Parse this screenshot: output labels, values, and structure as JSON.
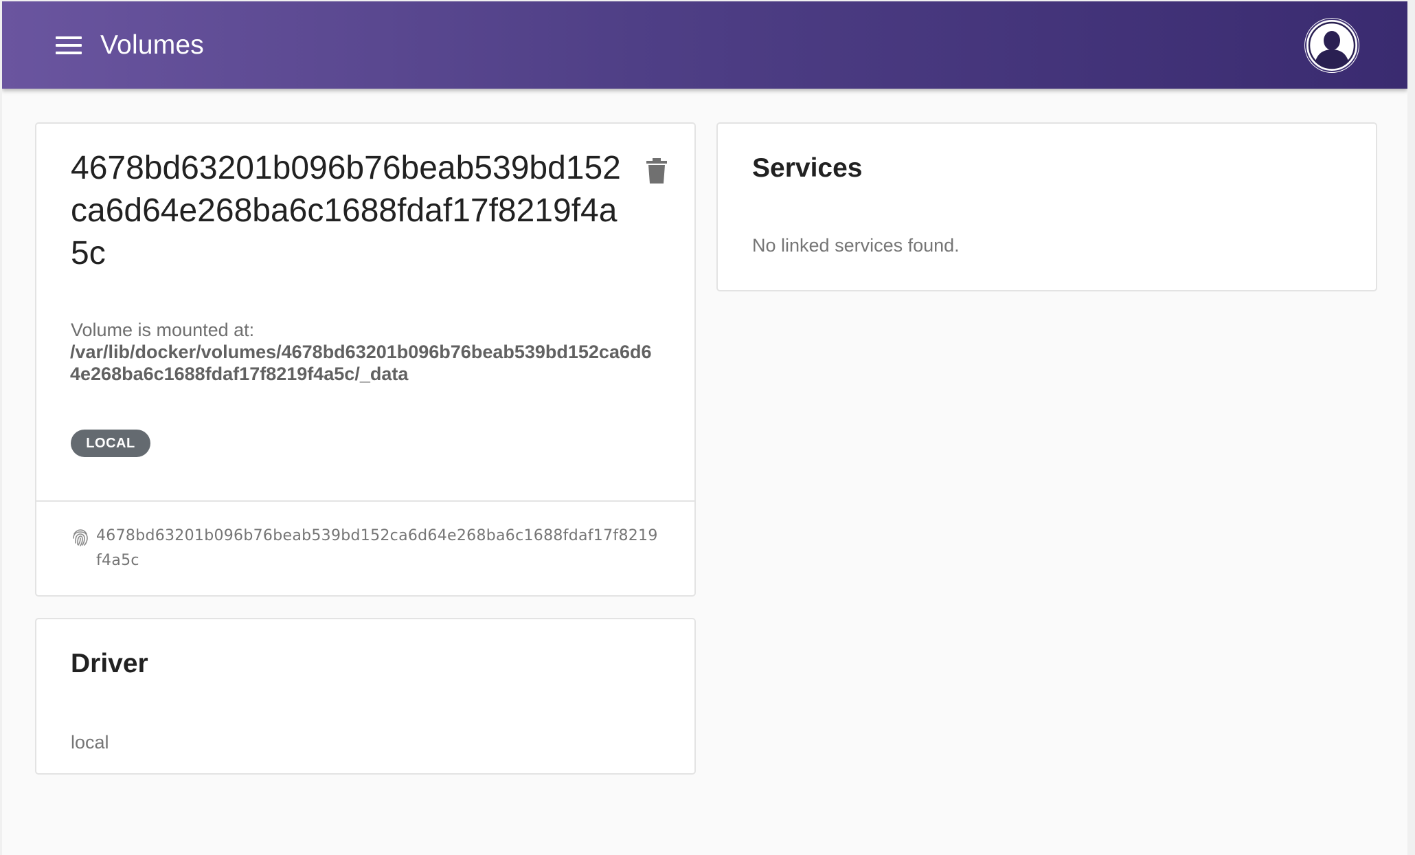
{
  "header": {
    "title": "Volumes",
    "menu_icon": "menu-icon",
    "avatar_icon": "account-circle-icon"
  },
  "volume": {
    "name": "4678bd63201b096b76beab539bd152ca6d64e268ba6c1688fdaf17f8219f4a5c",
    "mounted_label": "Volume is mounted at:",
    "mount_path": "/var/lib/docker/volumes/4678bd63201b096b76beab539bd152ca6d64e268ba6c1688fdaf17f8219f4a5c/_data",
    "driver_badge": "LOCAL",
    "id": "4678bd63201b096b76beab539bd152ca6d64e268ba6c1688fdaf17f8219f4a5c",
    "delete_icon": "trash-icon",
    "id_icon": "fingerprint-icon"
  },
  "driver": {
    "title": "Driver",
    "value": "local"
  },
  "services": {
    "title": "Services",
    "empty_message": "No linked services found."
  },
  "colors": {
    "header_start": "#6a559f",
    "header_end": "#3a2b70",
    "badge": "#646a70"
  }
}
